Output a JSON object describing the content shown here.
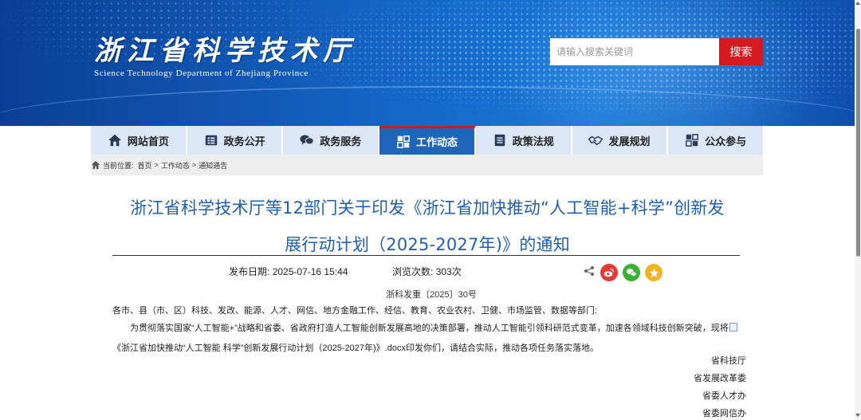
{
  "header": {
    "logo_title": "浙江省科学技术厅",
    "logo_subtitle": "Science Technology Department of Zhejiang Province",
    "search_placeholder": "请输入搜索关键词",
    "search_button": "搜索"
  },
  "nav": {
    "items": [
      {
        "label": "网站首页",
        "icon": "home-icon"
      },
      {
        "label": "政务公开",
        "icon": "list-icon"
      },
      {
        "label": "政务服务",
        "icon": "chat-icon"
      },
      {
        "label": "工作动态",
        "icon": "dynamic-icon",
        "active": true
      },
      {
        "label": "政策法规",
        "icon": "document-icon"
      },
      {
        "label": "发展规划",
        "icon": "handshake-icon"
      },
      {
        "label": "公众参与",
        "icon": "participation-icon"
      }
    ]
  },
  "breadcrumb": {
    "prefix": "当前位置:",
    "items": [
      "首页",
      "工作动态",
      "通知通告"
    ],
    "sep": ">"
  },
  "article": {
    "title_line1": "浙江省科学技术厅等12部门关于印发《浙江省加快推动“人工智能+科学”创新发",
    "title_line2": "展行动计划（2025-2027年)》的通知",
    "publish_label": "发布日期:",
    "publish_date": "2025-07-16 15:44",
    "views_label": "浏览次数:",
    "views": "303次",
    "doc_number": "浙科发重〔2025〕30号",
    "recipients": "各市、县（市、区）科技、发改、能源、人才、网信、地方金融工作、经信、教育、农业农村、卫健、市场监管、数据等部门:",
    "body_part1": "为贯彻落实国家“人工智能+”战略和省委、省政府打造人工智能创新发展高地的决策部署，推动人工智能引领科研范式变革，加速各领域科技创新突破，现将",
    "body_link": "《浙江省加快推动“人工智能 科学”创新发展行动计划（2025-2027年)》.docx",
    "body_part2": "印发你们，请结合实际，推动各项任务落实落地。",
    "signers": [
      "省科技厅",
      "省发展改革委",
      "省委人才办",
      "省委网信办"
    ]
  },
  "colors": {
    "nav_active": "#1f66ba",
    "accent_red": "#d51a1f",
    "title_blue": "#1f5fae",
    "weibo": "#e53935",
    "wechat": "#3cb034",
    "favorite": "#f2b322"
  }
}
